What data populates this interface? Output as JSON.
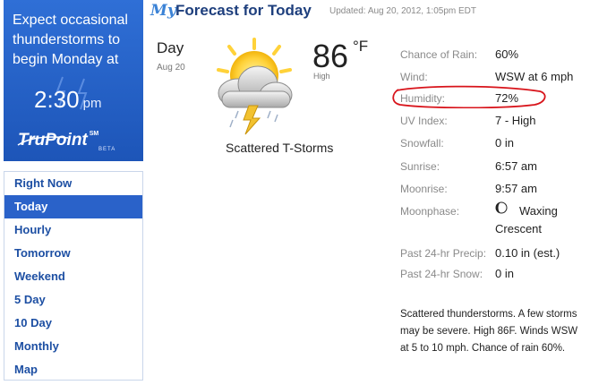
{
  "promo": {
    "headline": "Expect occasional thunderstorms to begin Monday at",
    "time": "2:30",
    "ampm": "pm",
    "logo": "TruPoint",
    "logo_sm": "SM",
    "logo_beta": "BETA"
  },
  "nav": {
    "items": [
      "Right Now",
      "Today",
      "Hourly",
      "Tomorrow",
      "Weekend",
      "5 Day",
      "10 Day",
      "Monthly",
      "Map"
    ],
    "active": "Today"
  },
  "header": {
    "my": "My",
    "title": "Forecast for Today",
    "updated": "Updated: Aug 20, 2012, 1:05pm EDT"
  },
  "forecast": {
    "day": "Day",
    "date": "Aug 20",
    "temp": "86",
    "unit": "°F",
    "temp_label": "High",
    "condition": "Scattered T-Storms",
    "icon": "thunderstorm-icon"
  },
  "details": [
    {
      "label": "Chance of Rain:",
      "value": "60%"
    },
    {
      "label": "Wind:",
      "value": "WSW at 6 mph"
    },
    {
      "label": "Humidity:",
      "value": "72%"
    },
    {
      "label": "UV Index:",
      "value": "7 - High"
    },
    {
      "label": "Snowfall:",
      "value": "0 in"
    },
    {
      "label": "Sunrise:",
      "value": "6:57 am"
    },
    {
      "label": "Moonrise:",
      "value": "9:57 am"
    },
    {
      "label": "Moonphase:",
      "value": "Waxing",
      "value2": "Crescent",
      "icon": "moon-phase-icon"
    },
    {
      "label": "Past 24-hr Precip:",
      "value": "0.10 in (est.)"
    },
    {
      "label": "Past 24-hr Snow:",
      "value": "0 in"
    }
  ],
  "description": "Scattered thunderstorms. A few storms may be severe. High 86F. Winds WSW at 5 to 10 mph. Chance of rain 60%.",
  "colors": {
    "promo_blue": "#2a62c9",
    "nav_link": "#1d4fa3",
    "annotation_red": "#d8141b"
  }
}
